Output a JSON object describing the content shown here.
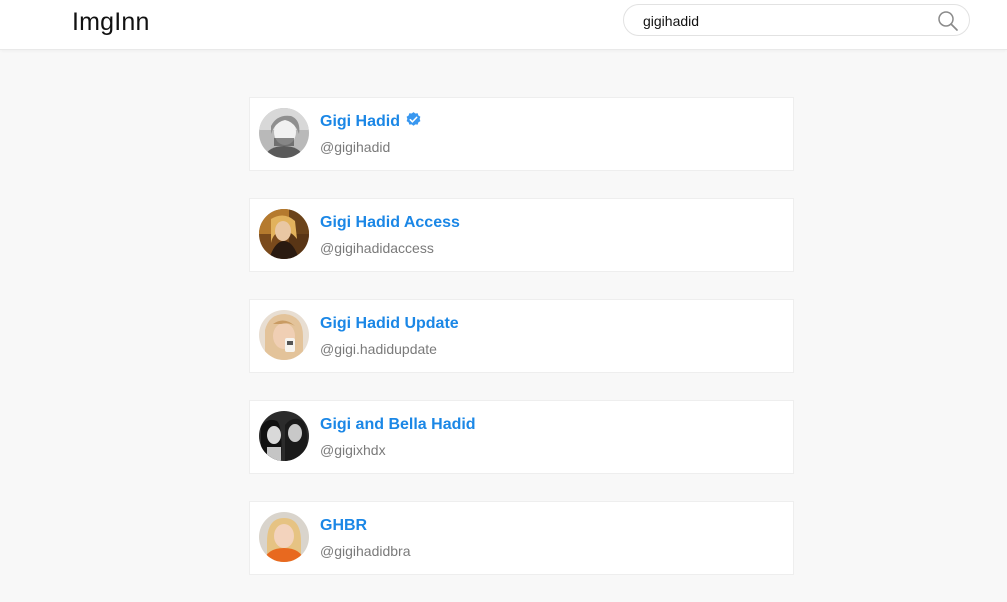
{
  "app": {
    "logo": "ImgInn"
  },
  "search": {
    "value": "gigihadid",
    "icon": "search-icon"
  },
  "colors": {
    "name_link": "#1b87e6",
    "username": "#7a7a7a",
    "verified": "#3897f0",
    "background": "#f8f8f8"
  },
  "results": [
    {
      "name": "Gigi Hadid",
      "username": "@gigihadid",
      "verified": true,
      "avatar": "avatar-bw-portrait"
    },
    {
      "name": "Gigi Hadid Access",
      "username": "@gigihadidaccess",
      "verified": false,
      "avatar": "avatar-warm-portrait"
    },
    {
      "name": "Gigi Hadid Update",
      "username": "@gigi.hadidupdate",
      "verified": false,
      "avatar": "avatar-blonde-portrait"
    },
    {
      "name": "Gigi and Bella Hadid",
      "username": "@gigixhdx",
      "verified": false,
      "avatar": "avatar-duo-bw-portrait"
    },
    {
      "name": "GHBR",
      "username": "@gigihadidbra",
      "verified": false,
      "avatar": "avatar-orange-portrait"
    }
  ]
}
